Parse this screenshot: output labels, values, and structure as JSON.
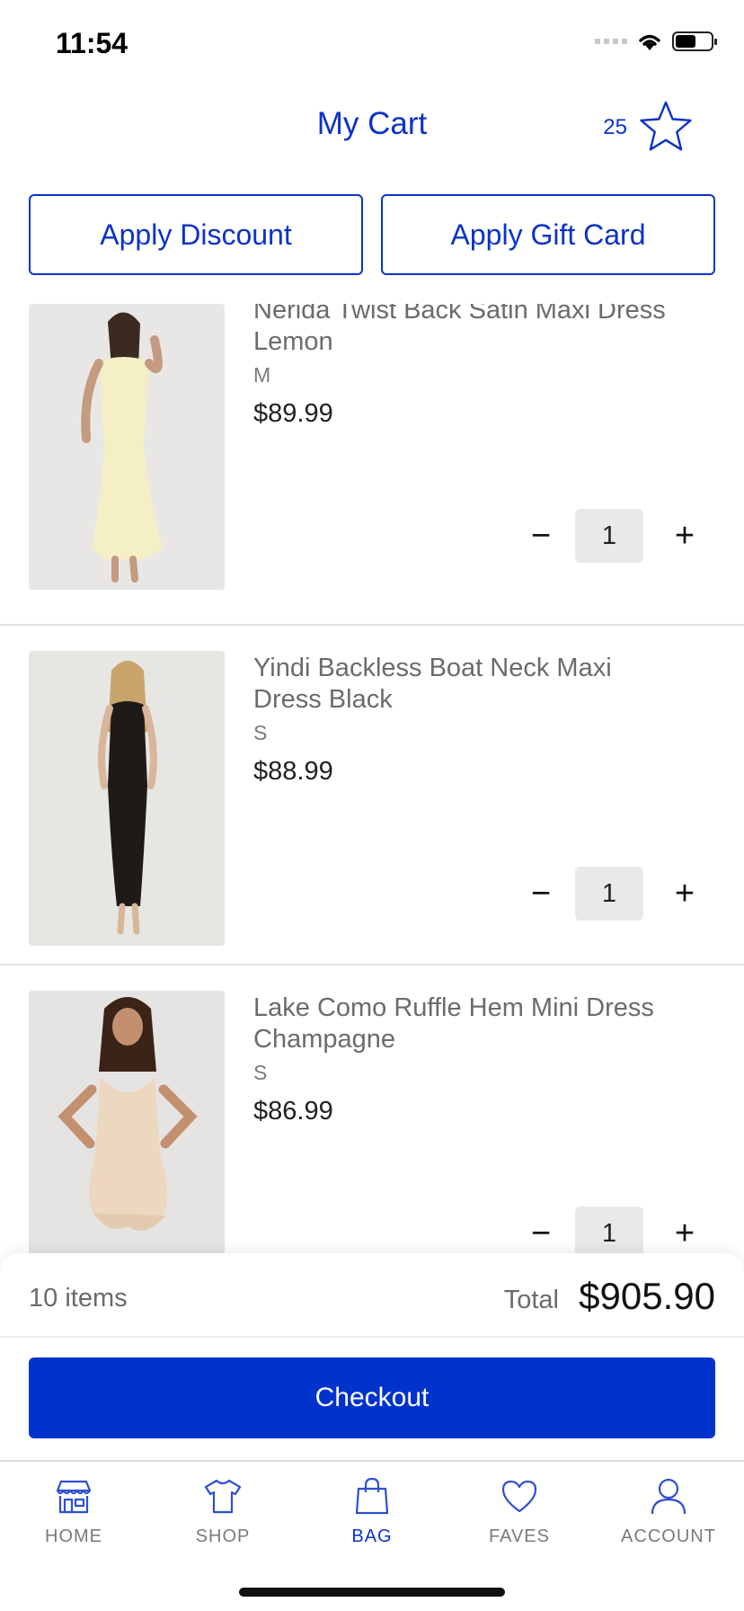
{
  "status_bar": {
    "time": "11:54"
  },
  "header": {
    "title": "My Cart",
    "favorites_count": "25"
  },
  "actions": {
    "discount_label": "Apply Discount",
    "gift_card_label": "Apply Gift Card"
  },
  "cart_items": [
    {
      "name": "Nerida Twist Back Satin Maxi Dress Lemon",
      "size": "M",
      "price": "$89.99",
      "quantity": "1"
    },
    {
      "name": "Yindi Backless Boat Neck Maxi Dress Black",
      "size": "S",
      "price": "$88.99",
      "quantity": "1"
    },
    {
      "name": "Lake Como Ruffle Hem Mini Dress Champagne",
      "size": "S",
      "price": "$86.99",
      "quantity": "1"
    }
  ],
  "summary": {
    "items_count": "10 items",
    "total_label": "Total",
    "total_value": "$905.90",
    "checkout_label": "Checkout"
  },
  "tabbar": {
    "home": "HOME",
    "shop": "SHOP",
    "bag": "BAG",
    "faves": "FAVES",
    "account": "ACCOUNT",
    "active": "bag"
  },
  "colors": {
    "accent": "#0033cc",
    "text_accent": "#0b33c7",
    "divider": "#e3e3e3"
  }
}
